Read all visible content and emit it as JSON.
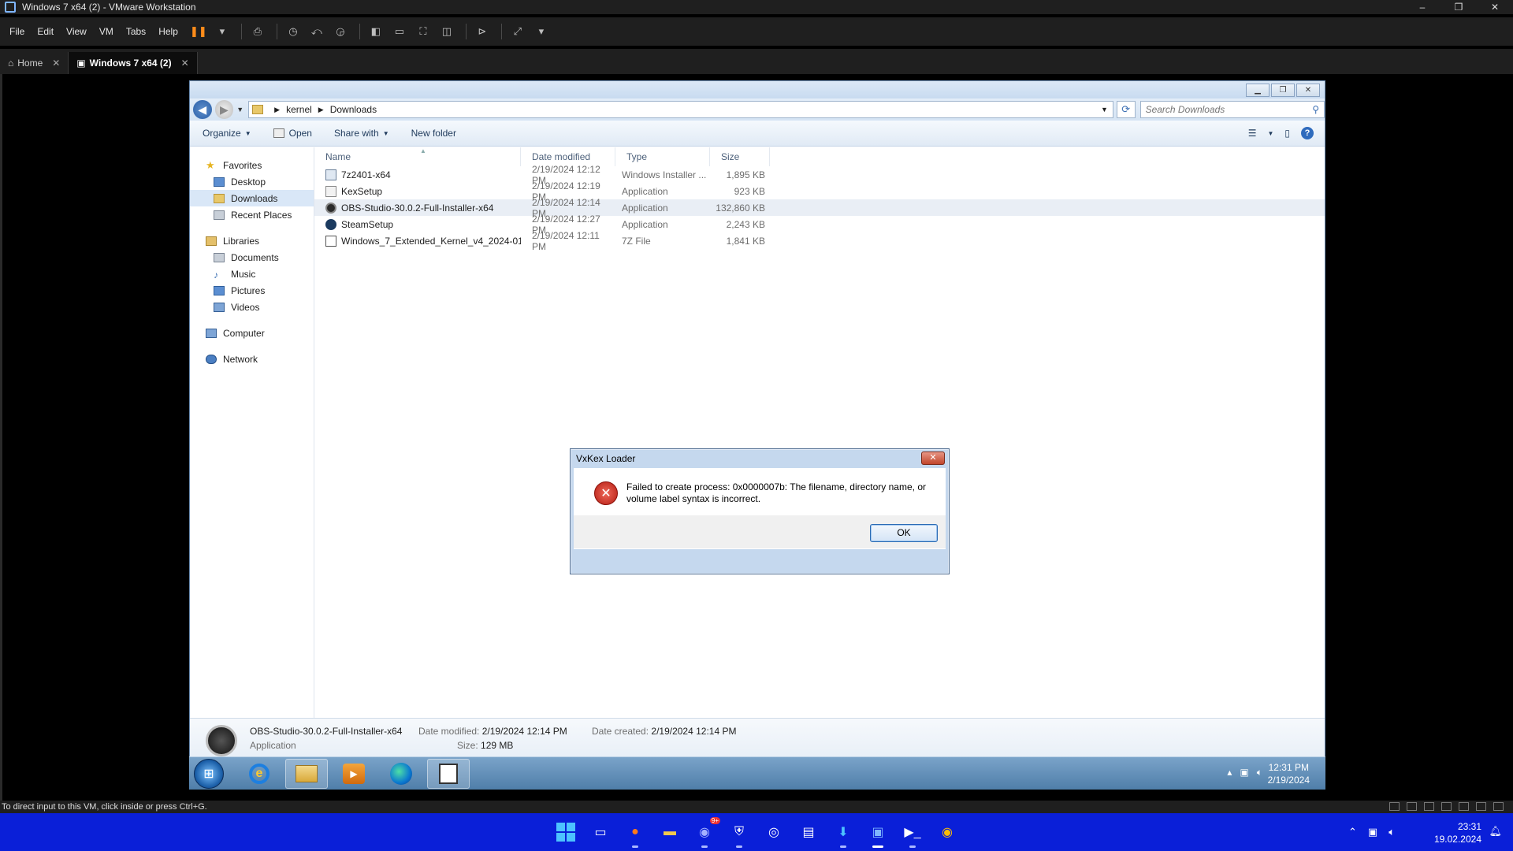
{
  "vm": {
    "title": "Windows 7 x64 (2) - VMware Workstation",
    "window_buttons": [
      "–",
      "❐",
      "✕"
    ],
    "menu": [
      "File",
      "Edit",
      "View",
      "VM",
      "Tabs",
      "Help"
    ],
    "tabs": [
      {
        "label": "Home",
        "close": "✕"
      },
      {
        "label": "Windows 7 x64 (2)",
        "close": "✕"
      }
    ],
    "status_text": "To direct input to this VM, click inside or press Ctrl+G."
  },
  "explorer": {
    "breadcrumb": [
      "kernel",
      "Downloads"
    ],
    "search_placeholder": "Search Downloads",
    "toolbar": {
      "organize": "Organize",
      "open": "Open",
      "share_with": "Share with",
      "new_folder": "New folder"
    },
    "nav": {
      "favorites": "Favorites",
      "favorites_items": [
        "Desktop",
        "Downloads",
        "Recent Places"
      ],
      "libraries": "Libraries",
      "libraries_items": [
        "Documents",
        "Music",
        "Pictures",
        "Videos"
      ],
      "computer": "Computer",
      "network": "Network"
    },
    "columns": {
      "name": "Name",
      "date": "Date modified",
      "type": "Type",
      "size": "Size"
    },
    "files": [
      {
        "name": "7z2401-x64",
        "date": "2/19/2024 12:12 PM",
        "type": "Windows Installer ...",
        "size": "1,895 KB",
        "icon": "msi-icon"
      },
      {
        "name": "KexSetup",
        "date": "2/19/2024 12:19 PM",
        "type": "Application",
        "size": "923 KB",
        "icon": "app-icon"
      },
      {
        "name": "OBS-Studio-30.0.2-Full-Installer-x64",
        "date": "2/19/2024 12:14 PM",
        "type": "Application",
        "size": "132,860 KB",
        "icon": "obs-icon"
      },
      {
        "name": "SteamSetup",
        "date": "2/19/2024 12:27 PM",
        "type": "Application",
        "size": "2,243 KB",
        "icon": "steam-icon"
      },
      {
        "name": "Windows_7_Extended_Kernel_v4_2024-01...",
        "date": "2/19/2024 12:11 PM",
        "type": "7Z File",
        "size": "1,841 KB",
        "icon": "7z-icon"
      }
    ],
    "details": {
      "name": "OBS-Studio-30.0.2-Full-Installer-x64",
      "type": "Application",
      "modified_label": "Date modified:",
      "modified": "2/19/2024 12:14 PM",
      "size_label": "Size:",
      "size": "129 MB",
      "created_label": "Date created:",
      "created": "2/19/2024 12:14 PM"
    }
  },
  "dialog": {
    "title": "VxKex Loader",
    "message": "Failed to create process: 0x0000007b: The filename, directory name, or volume label syntax is incorrect.",
    "ok": "OK"
  },
  "guest_taskbar": {
    "time": "12:31 PM",
    "date": "2/19/2024"
  },
  "host_taskbar": {
    "time": "23:31",
    "date": "19.02.2024",
    "discord_badge": "9+"
  }
}
